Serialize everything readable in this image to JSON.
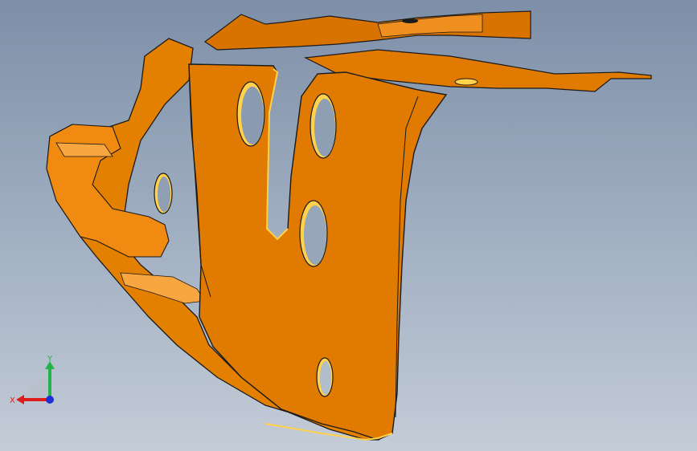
{
  "viewport": {
    "background_top": "#7d8fa8",
    "background_bottom": "#c4ccd7",
    "part_color": "#e07a00",
    "part_highlight": "#f29a2a",
    "edge_color": "#1a1a1a",
    "hole_highlight": "#ffd24a"
  },
  "triad": {
    "x_label": "X",
    "y_label": "Y",
    "x_color": "#e01b1b",
    "y_color": "#22b34a",
    "z_color": "#1e2fd6"
  }
}
